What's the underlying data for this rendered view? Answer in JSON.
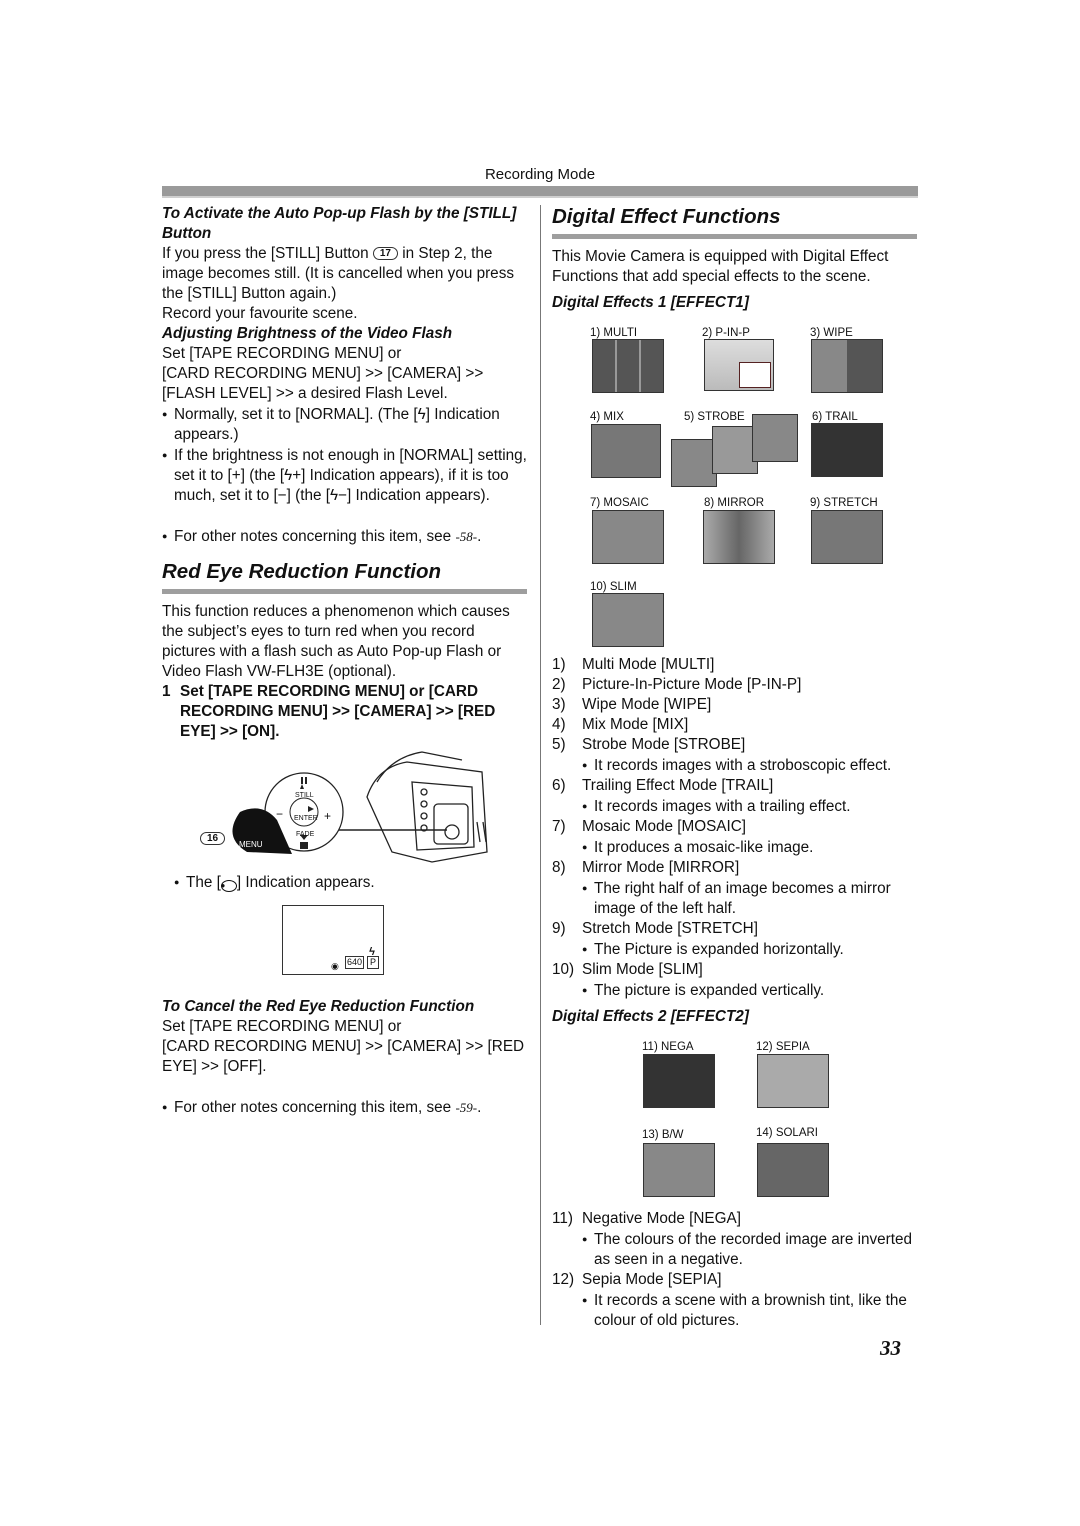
{
  "header": {
    "title": "Recording Mode"
  },
  "left": {
    "flash_heading": "To Activate the Auto Pop-up Flash by the [STILL] Button",
    "flash_p1_a": "If you press the [STILL] Button",
    "flash_p1_badge": "17",
    "flash_p1_b": "in Step 2, the image becomes still. (It is cancelled when you press the [STILL] Button again.)",
    "flash_p2": "Record your favourite scene.",
    "bright_heading": "Adjusting Brightness of the Video Flash",
    "bright_p1": "Set [TAPE RECORDING MENU] or",
    "bright_p2": "[CARD RECORDING MENU] >> [CAMERA] >> [FLASH LEVEL] >> a desired Flash Level.",
    "bright_b1": "Normally, set it to [NORMAL]. (The [ϟ] Indication appears.)",
    "bright_b2": "If the brightness is not enough in [NORMAL] setting, set it to [+] (the [ϟ+] Indication appears), if it is too much, set it to [−] (the [ϟ−] Indication appears).",
    "bright_note": "For other notes concerning this item, see",
    "bright_note_ref": "-58-",
    "redeye_title": "Red Eye Reduction Function",
    "redeye_p1": "This function reduces a phenomenon which causes the subject’s eyes to turn red when you record pictures with a flash such as Auto Pop-up Flash or Video Flash VW-FLH3E (optional).",
    "step1_num": "1",
    "step1_text": "Set [TAPE RECORDING MENU] or [CARD RECORDING MENU] >> [CAMERA] >> [RED EYE] >> [ON].",
    "illus": {
      "badge": "16",
      "menu": "MENU",
      "still": "STILL",
      "enter": "ENTER",
      "fade": "FADE",
      "minus": "−",
      "plus": "+"
    },
    "indication_a": "The [",
    "indication_b": "] Indication appears.",
    "lcd": {
      "res": "640",
      "mode": "P",
      "flash": "ϟ"
    },
    "cancel_heading": "To Cancel the Red Eye Reduction Function",
    "cancel_p1": "Set [TAPE RECORDING MENU] or",
    "cancel_p2": "[CARD RECORDING MENU] >> [CAMERA] >> [RED EYE] >> [OFF].",
    "cancel_note": "For other notes concerning this item, see",
    "cancel_note_ref": "-59-"
  },
  "right": {
    "title": "Digital Effect Functions",
    "intro": "This Movie Camera is equipped with Digital Effect Functions that add special effects to the scene.",
    "effect1_heading": "Digital Effects 1 [EFFECT1]",
    "thumbs1": [
      "1) MULTI",
      "2) P-IN-P",
      "3) WIPE",
      "4) MIX",
      "5) STROBE",
      "6) TRAIL",
      "7) MOSAIC",
      "8) MIRROR",
      "9) STRETCH",
      "10) SLIM"
    ],
    "list1": [
      {
        "n": "1)",
        "t": "Multi Mode [MULTI]"
      },
      {
        "n": "2)",
        "t": "Picture-In-Picture Mode [P-IN-P]"
      },
      {
        "n": "3)",
        "t": "Wipe Mode [WIPE]"
      },
      {
        "n": "4)",
        "t": "Mix Mode [MIX]"
      },
      {
        "n": "5)",
        "t": "Strobe Mode [STROBE]",
        "b": [
          "It records images with a stroboscopic effect."
        ]
      },
      {
        "n": "6)",
        "t": "Trailing Effect Mode [TRAIL]",
        "b": [
          "It records images with a trailing effect."
        ]
      },
      {
        "n": "7)",
        "t": "Mosaic Mode [MOSAIC]",
        "b": [
          "It produces a mosaic-like image."
        ]
      },
      {
        "n": "8)",
        "t": "Mirror Mode [MIRROR]",
        "b": [
          "The right half of an image becomes a mirror image of the left half."
        ]
      },
      {
        "n": "9)",
        "t": "Stretch Mode [STRETCH]",
        "b": [
          "The Picture is expanded horizontally."
        ]
      },
      {
        "n": "10)",
        "t": "Slim Mode [SLIM]",
        "b": [
          "The picture is expanded vertically."
        ]
      }
    ],
    "effect2_heading": "Digital Effects 2 [EFFECT2]",
    "thumbs2": [
      "11) NEGA",
      "12) SEPIA",
      "13) B/W",
      "14) SOLARI"
    ],
    "list2": [
      {
        "n": "11)",
        "t": "Negative Mode [NEGA]",
        "b": [
          "The colours of the recorded image are inverted as seen in a negative."
        ]
      },
      {
        "n": "12)",
        "t": "Sepia Mode [SEPIA]",
        "b": [
          "It records a scene with a brownish tint, like the colour of old pictures."
        ]
      }
    ]
  },
  "page_number": "33"
}
